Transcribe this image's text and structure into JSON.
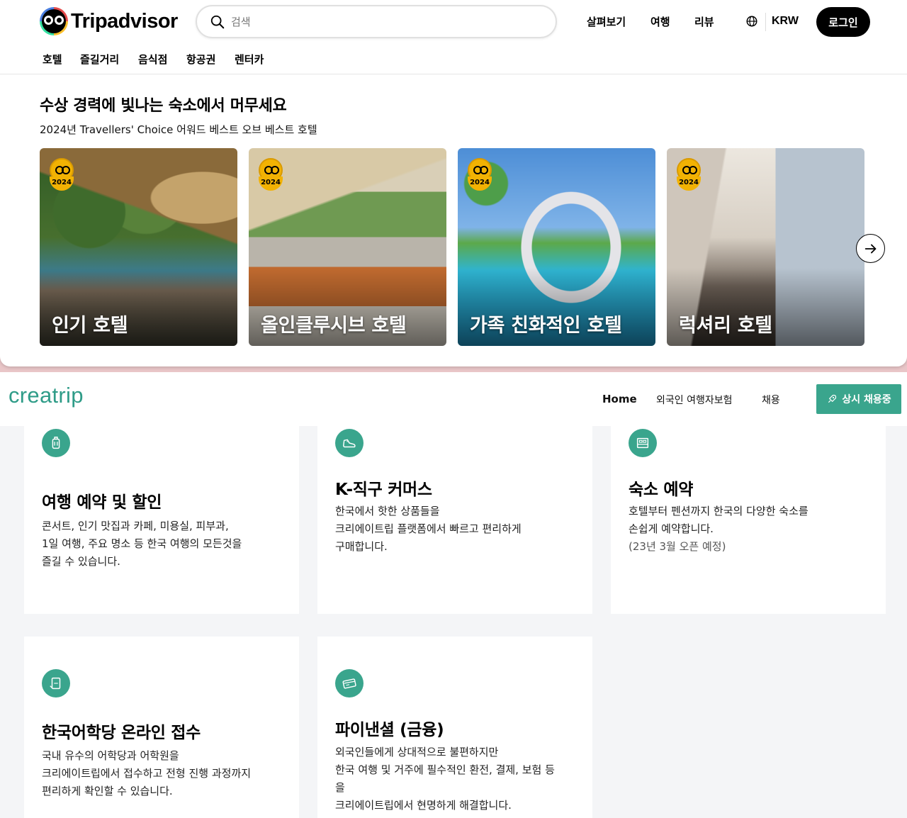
{
  "tripadvisor": {
    "brand": "Tripadvisor",
    "search": {
      "placeholder": "검색"
    },
    "nav": [
      "살펴보기",
      "여행",
      "리뷰"
    ],
    "currency": "KRW",
    "login": "로그인",
    "subnav": [
      "호텔",
      "즐길거리",
      "음식점",
      "항공권",
      "렌터카"
    ],
    "heading": "수상 경력에 빛나는 숙소에서 머무세요",
    "subheading": "2024년 Travellers' Choice 어워드 베스트 오브 베스트 호텔",
    "badge_year": "2024",
    "cards": [
      {
        "label": "인기 호텔"
      },
      {
        "label": "올인클루시브 호텔"
      },
      {
        "label": "가족 친화적인 호텔"
      },
      {
        "label": "럭셔리 호텔"
      }
    ]
  },
  "creatrip": {
    "brand": "creatrip",
    "nav": {
      "home": "Home",
      "insurance": "외국인 여행자보험",
      "jobs": "채용"
    },
    "hire_button": "상시 채용중",
    "services": [
      {
        "icon": "luggage-icon",
        "title": "여행 예약 및 할인",
        "lines": [
          "콘서트, 인기 맛집과 카페, 미용실, 피부과,",
          "1일 여행, 주요 명소 등 한국 여행의 모든것을",
          "즐길 수 있습니다."
        ]
      },
      {
        "icon": "shoe-icon",
        "title": "K-직구 커머스",
        "lines": [
          "한국에서 핫한 상품들을",
          "크리에이트립 플랫폼에서 빠르고 편리하게",
          "구매합니다."
        ]
      },
      {
        "icon": "bed-icon",
        "title": "숙소 예약",
        "lines": [
          "호텔부터 펜션까지 한국의 다양한 숙소를",
          "손쉽게 예약합니다."
        ],
        "note": "(23년 3월 오픈 예정)"
      },
      {
        "icon": "form-icon",
        "title": "한국어학당 온라인 접수",
        "lines": [
          "국내 유수의 어학당과 어학원을",
          "크리에이트립에서 접수하고 전형 진행 과정까지",
          "편리하게 확인할 수 있습니다."
        ]
      },
      {
        "icon": "card-icon",
        "title": "파이낸셜 (금융)",
        "lines": [
          "외국인들에게 상대적으로 불편하지만",
          "한국 여행 및 거주에 필수적인 환전, 결제, 보험 등",
          "을",
          "크리에이트립에서 현명하게 해결합니다."
        ]
      }
    ]
  },
  "colors": {
    "creatrip_green": "#3aa58d",
    "tripadvisor_black": "#000000"
  }
}
